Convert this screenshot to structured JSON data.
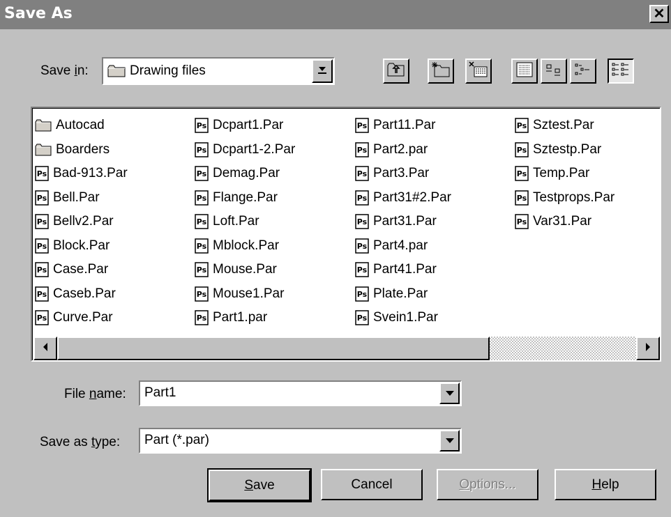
{
  "window": {
    "title": "Save As",
    "close_glyph": "✕"
  },
  "save_in": {
    "label_pre": "Save ",
    "label_accel": "i",
    "label_post": "n:",
    "value": "Drawing files",
    "icon": "folder-icon"
  },
  "toolbar": {
    "buttons": [
      {
        "name": "up-one-level-button",
        "icon": "up-folder-icon"
      },
      {
        "name": "create-new-folder-button",
        "icon": "new-folder-icon"
      },
      {
        "name": "delete-button",
        "icon": "delete-icon"
      },
      {
        "name": "list-view-button",
        "icon": "list-icon"
      },
      {
        "name": "large-icons-button",
        "icon": "large-icons-icon"
      },
      {
        "name": "details-button",
        "icon": "details-icon"
      },
      {
        "name": "thumbnails-button",
        "icon": "thumbnails-icon",
        "pressed": true
      }
    ]
  },
  "files": {
    "columns": [
      [
        {
          "name": "Autocad",
          "type": "folder"
        },
        {
          "name": "Boarders",
          "type": "folder"
        },
        {
          "name": "Bad-913.Par",
          "type": "part"
        },
        {
          "name": "Bell.Par",
          "type": "part"
        },
        {
          "name": "Bellv2.Par",
          "type": "part"
        },
        {
          "name": "Block.Par",
          "type": "part"
        },
        {
          "name": "Case.Par",
          "type": "part"
        },
        {
          "name": "Caseb.Par",
          "type": "part"
        },
        {
          "name": "Curve.Par",
          "type": "part"
        }
      ],
      [
        {
          "name": "Dcpart1.Par",
          "type": "part"
        },
        {
          "name": "Dcpart1-2.Par",
          "type": "part"
        },
        {
          "name": "Demag.Par",
          "type": "part"
        },
        {
          "name": "Flange.Par",
          "type": "part"
        },
        {
          "name": "Loft.Par",
          "type": "part"
        },
        {
          "name": "Mblock.Par",
          "type": "part"
        },
        {
          "name": "Mouse.Par",
          "type": "part"
        },
        {
          "name": "Mouse1.Par",
          "type": "part"
        },
        {
          "name": "Part1.par",
          "type": "part"
        }
      ],
      [
        {
          "name": "Part11.Par",
          "type": "part"
        },
        {
          "name": "Part2.par",
          "type": "part"
        },
        {
          "name": "Part3.Par",
          "type": "part"
        },
        {
          "name": "Part31#2.Par",
          "type": "part"
        },
        {
          "name": "Part31.Par",
          "type": "part"
        },
        {
          "name": "Part4.par",
          "type": "part"
        },
        {
          "name": "Part41.Par",
          "type": "part"
        },
        {
          "name": "Plate.Par",
          "type": "part"
        },
        {
          "name": "Svein1.Par",
          "type": "part"
        }
      ],
      [
        {
          "name": "Sztest.Par",
          "type": "part"
        },
        {
          "name": "Sztestp.Par",
          "type": "part"
        },
        {
          "name": "Temp.Par",
          "type": "part"
        },
        {
          "name": "Testprops.Par",
          "type": "part"
        },
        {
          "name": "Var31.Par",
          "type": "part"
        }
      ]
    ]
  },
  "file_name": {
    "label_pre": "File ",
    "label_accel": "n",
    "label_post": "ame:",
    "value": "Part1"
  },
  "save_as_type": {
    "label_pre": "Save as ",
    "label_accel": "t",
    "label_post": "ype:",
    "value": "Part (*.par)"
  },
  "buttons": {
    "save": {
      "accel": "S",
      "rest": "ave"
    },
    "cancel": {
      "label": "Cancel"
    },
    "options": {
      "accel": "O",
      "rest": "ptions...",
      "disabled": true
    },
    "help": {
      "accel": "H",
      "rest": "elp"
    }
  },
  "colors": {
    "face": "#c0c0c0",
    "titlebar": "#808080",
    "window": "#ffffff"
  }
}
